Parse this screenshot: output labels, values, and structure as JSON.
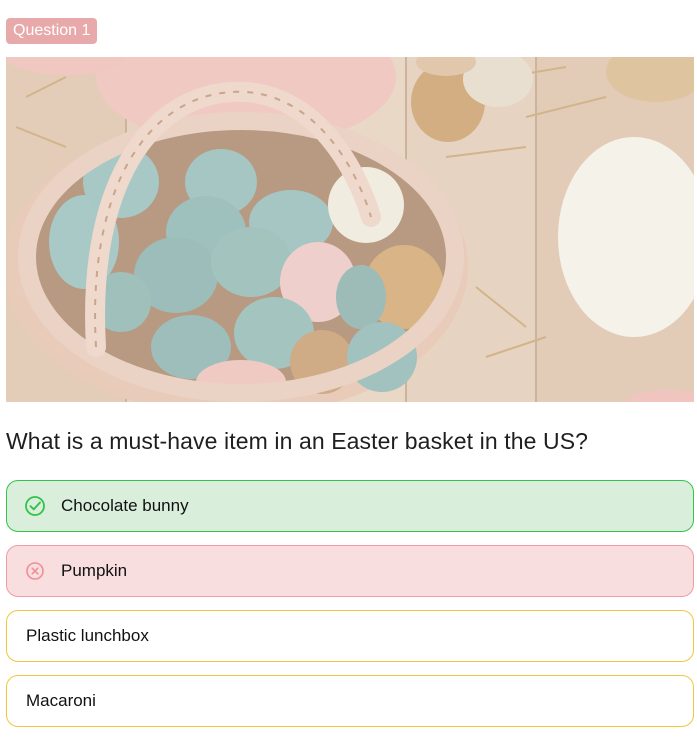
{
  "badge": {
    "label": "Question 1"
  },
  "question": {
    "text": "What is a must-have item in an Easter basket in the US?"
  },
  "options": [
    {
      "label": "Chocolate bunny",
      "state": "correct",
      "icon": "check-circle-icon"
    },
    {
      "label": "Pumpkin",
      "state": "wrong",
      "icon": "x-circle-icon"
    },
    {
      "label": "Plastic lunchbox",
      "state": "neutral"
    },
    {
      "label": "Macaroni",
      "state": "neutral"
    }
  ],
  "colors": {
    "badge_bg": "#e8a9aa",
    "correct_bg": "#d9efdc",
    "correct_border": "#33c24a",
    "wrong_bg": "#f8dede",
    "wrong_border": "#ee9ea3",
    "neutral_border": "#f0c73c"
  }
}
